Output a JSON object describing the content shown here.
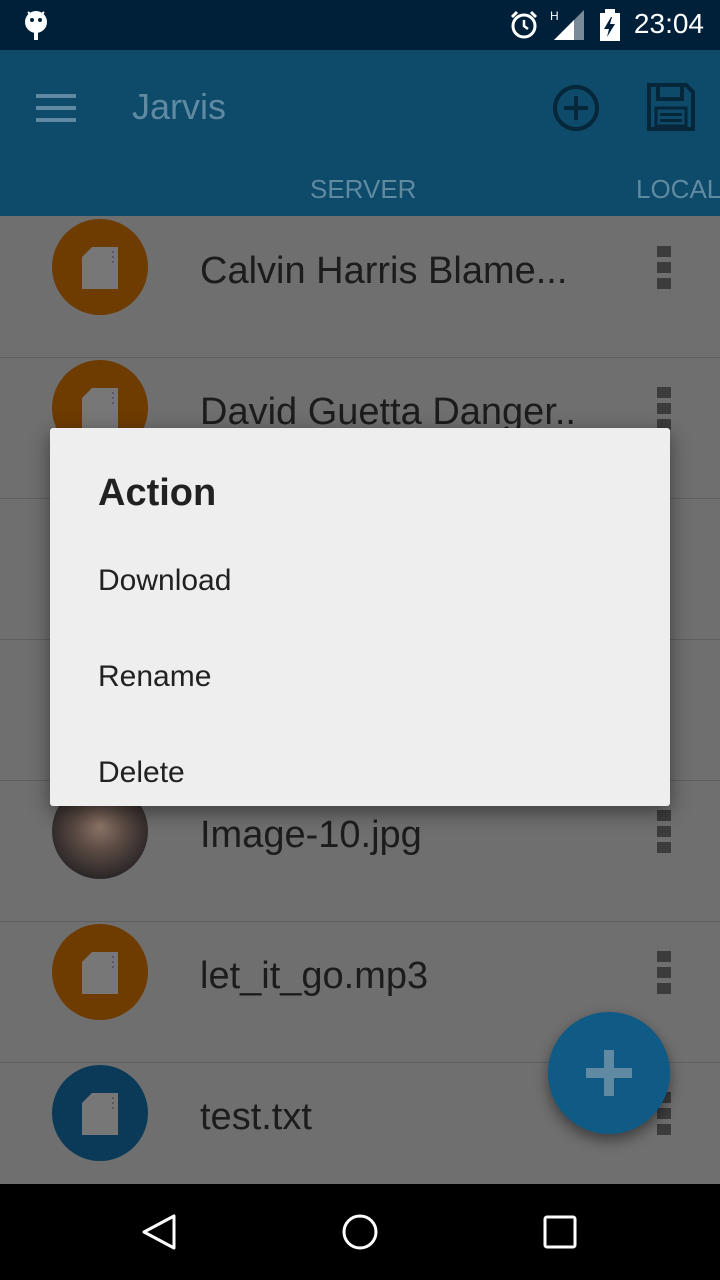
{
  "status_bar": {
    "time": "23:04",
    "signal_label": "H",
    "icons": [
      "android-icon",
      "alarm-icon",
      "signal-icon",
      "battery-charging-icon"
    ]
  },
  "app_bar": {
    "title": "Jarvis",
    "tabs": [
      {
        "label": "SERVER",
        "selected": true
      },
      {
        "label": "LOCAL",
        "selected": false
      }
    ]
  },
  "files": [
    {
      "name": "Calvin Harris Blame...",
      "icon": "file-icon",
      "color": "#6e3b00"
    },
    {
      "name": "David Guetta Danger..",
      "icon": "file-icon",
      "color": "#6e3b00"
    },
    {
      "name": "Image-10.jpg",
      "icon": "photo-thumbnail"
    },
    {
      "name": "let_it_go.mp3",
      "icon": "file-icon",
      "color": "#6e3b00"
    },
    {
      "name": "test.txt",
      "icon": "file-icon",
      "color": "#0b3a58"
    }
  ],
  "dialog": {
    "title": "Action",
    "items": [
      "Download",
      "Rename",
      "Delete"
    ]
  },
  "colors": {
    "status_bar": "#00203a",
    "app_bar": "#0e4a6a",
    "dialog_bg": "#eeeeee",
    "fab": "#0f5b86",
    "scrim_bg": "#6f6f6f"
  }
}
